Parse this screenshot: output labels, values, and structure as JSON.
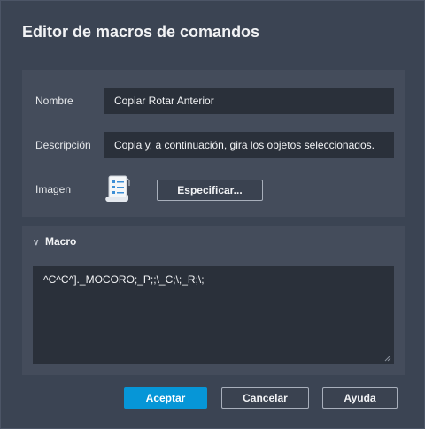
{
  "dialog": {
    "title": "Editor de macros de comandos"
  },
  "properties": {
    "name_label": "Nombre",
    "name_value": "Copiar Rotar Anterior",
    "description_label": "Descripción",
    "description_value": "Copia y, a continuación, gira los objetos seleccionados.",
    "image_label": "Imagen",
    "image_icon": "document-list-icon",
    "specify_button": "Especificar..."
  },
  "macro": {
    "heading": "Macro",
    "value": "^C^C^]._MOCORO;_P;;\\_C;\\;_R;\\;"
  },
  "buttons": {
    "accept": "Aceptar",
    "cancel": "Cancelar",
    "help": "Ayuda"
  },
  "colors": {
    "background": "#3b4453",
    "panel": "#444c5b",
    "field": "#2a303a",
    "accent": "#0696d7"
  }
}
